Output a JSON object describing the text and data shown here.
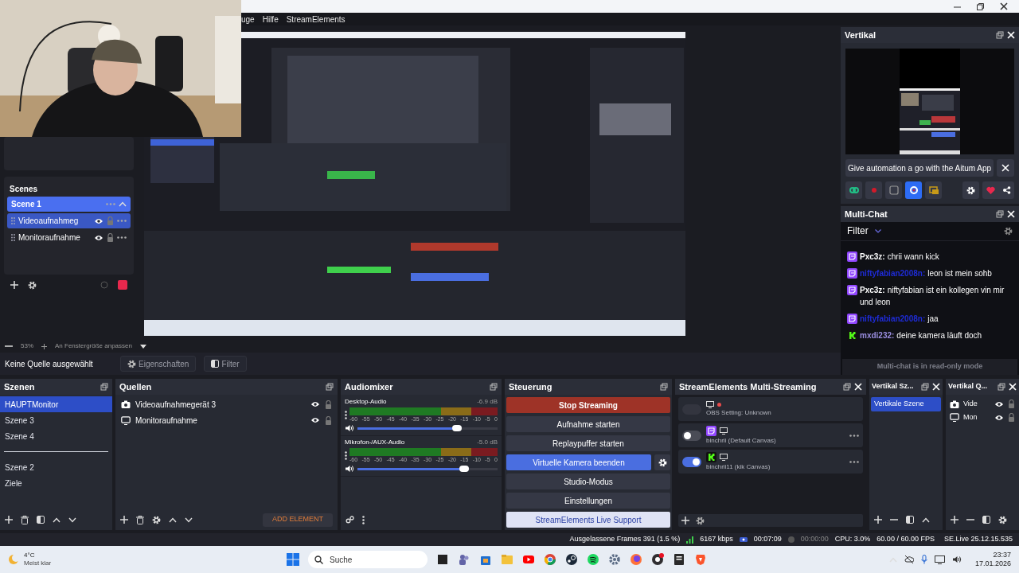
{
  "menu": [
    "uge",
    "Hilfe",
    "StreamElements"
  ],
  "aitum_scenes": {
    "title": "Scenes",
    "items": [
      {
        "label": "Scene 1",
        "kind": "scene",
        "selected": true
      },
      {
        "label": "Videoaufnahmeg",
        "kind": "source",
        "selected": true
      },
      {
        "label": "Monitoraufnahme",
        "kind": "source",
        "selected": false
      }
    ]
  },
  "zoom_bar": {
    "value": "53%",
    "fit": "An Fenstergröße anpassen"
  },
  "source_toolbar": {
    "status": "Keine Quelle ausgewählt",
    "buttons": [
      {
        "label": "Eigenschaften",
        "kind": "gear"
      },
      {
        "label": "Filter",
        "kind": "filter"
      }
    ]
  },
  "vertical_dock": {
    "title": "Vertikal",
    "banner": "Give automation a go with the Aitum App",
    "tools": [
      {
        "kind": "link",
        "selected": false
      },
      {
        "kind": "record",
        "selected": false
      },
      {
        "kind": "square",
        "selected": false
      },
      {
        "kind": "ring",
        "selected": true
      },
      {
        "kind": "replay",
        "selected": false
      }
    ]
  },
  "multi_chat": {
    "title": "Multi-Chat",
    "filter": "Filter",
    "messages": [
      {
        "kind": "twitch",
        "user": "Pxc3z:",
        "color": "#ffffff",
        "text": "chrii wann kick"
      },
      {
        "kind": "twitch",
        "user": "niftyfabian2008n:",
        "color": "#1e2bd6",
        "text": "leon ist mein sohb"
      },
      {
        "kind": "twitch",
        "user": "Pxc3z:",
        "color": "#ffffff",
        "text": "niftyfabian ist ein kollegen vin mir und leon"
      },
      {
        "kind": "twitch",
        "user": "niftyfabian2008n:",
        "color": "#1e2bd6",
        "text": "jaa"
      },
      {
        "kind": "kick",
        "user": "mxdi232:",
        "color": "#9a8ee0",
        "text": "deine kamera läuft doch"
      }
    ],
    "footer": "Multi-chat is in read-only mode"
  },
  "scenes": {
    "title": "Szenen",
    "items": [
      {
        "label": "HAUPTMonitor",
        "selected": true,
        "divider_before": false
      },
      {
        "label": "Szene 3",
        "selected": false,
        "divider_before": false
      },
      {
        "label": "Szene 4",
        "selected": false,
        "divider_before": false
      },
      {
        "label": "Szene 2",
        "selected": false,
        "divider_before": true
      },
      {
        "label": "Ziele",
        "selected": false,
        "divider_before": false
      }
    ]
  },
  "sources": {
    "title": "Quellen",
    "items": [
      {
        "label": "Videoaufnahmegerät 3",
        "kind": "camera"
      },
      {
        "label": "Monitoraufnahme",
        "kind": "monitor"
      }
    ],
    "add_button": "ADD ELEMENT"
  },
  "audio_mixer": {
    "title": "Audiomixer",
    "channels": [
      {
        "name": "Desktop-Audio",
        "reading": "-6.9 dB",
        "level": 0.71,
        "ticks": [
          "-60",
          "-55",
          "-50",
          "-45",
          "-40",
          "-35",
          "-30",
          "-25",
          "-20",
          "-15",
          "-10",
          "-5",
          "0"
        ]
      },
      {
        "name": "Mikrofon-/AUX-Audio",
        "reading": "-5.0 dB",
        "level": 0.76,
        "ticks": [
          "-60",
          "-55",
          "-50",
          "-45",
          "-40",
          "-35",
          "-30",
          "-25",
          "-20",
          "-15",
          "-10",
          "-5",
          "0"
        ]
      }
    ]
  },
  "controls": {
    "title": "Steuerung",
    "buttons": [
      {
        "label": "Stop Streaming",
        "kind": "stop"
      },
      {
        "label": "Aufnahme starten",
        "kind": "normal"
      },
      {
        "label": "Replaypuffer starten",
        "kind": "normal"
      },
      {
        "label": "Virtuelle Kamera beenden",
        "kind": "active"
      },
      {
        "label": "Studio-Modus",
        "kind": "normal"
      },
      {
        "label": "Einstellungen",
        "kind": "normal"
      },
      {
        "label": "StreamElements Live Support",
        "kind": "support"
      }
    ]
  },
  "multistream": {
    "title": "StreamElements Multi-Streaming",
    "targets": [
      {
        "kind": "obs",
        "label": "OBS Setting: Unknown",
        "on": false,
        "disabled": true
      },
      {
        "kind": "twitch",
        "label": "binchrii (Default Canvas)",
        "on": false,
        "disabled": false
      },
      {
        "kind": "kick",
        "label": "binchrii11 (kik Canvas)",
        "on": true,
        "disabled": false
      }
    ]
  },
  "vertical_scenes": {
    "title": "Vertikal Sz...",
    "items": [
      {
        "label": "Vertikale Szene",
        "selected": true
      }
    ]
  },
  "vertical_sources": {
    "title": "Vertikal Q...",
    "items": [
      {
        "label": "Vide",
        "kind": "camera"
      },
      {
        "label": "Mon",
        "kind": "monitor"
      }
    ]
  },
  "status_bar": {
    "dropped": "Ausgelassene Frames 391 (1.5 %)",
    "bitrate": "6167 kbps",
    "stream_time": "00:07:09",
    "rec_time": "00:00:00",
    "cpu": "CPU: 3.0%",
    "fps": "60.00 / 60.00 FPS",
    "version": "SE.Live 25.12.15.535"
  },
  "taskbar": {
    "temperature": "4°C",
    "weather": "Meist klar",
    "search": "Suche",
    "time": "23:37",
    "date": "17.01.2026"
  }
}
